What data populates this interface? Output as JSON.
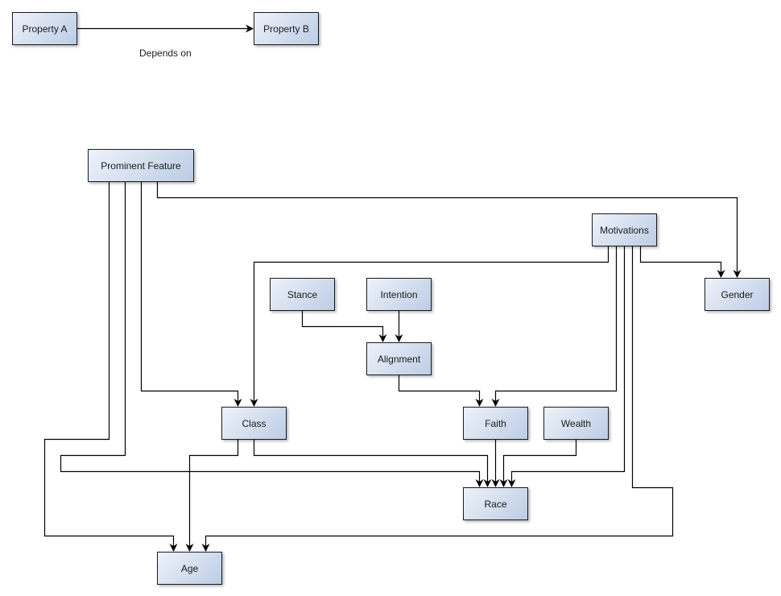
{
  "legend": {
    "source": "Property A",
    "target": "Property B",
    "edge_label": "Depends on"
  },
  "nodes": {
    "prominent_feature": "Prominent Feature",
    "motivations": "Motivations",
    "gender": "Gender",
    "stance": "Stance",
    "intention": "Intention",
    "alignment": "Alignment",
    "class": "Class",
    "faith": "Faith",
    "wealth": "Wealth",
    "race": "Race",
    "age": "Age"
  },
  "edges": [
    {
      "from": "Property A",
      "to": "Property B"
    },
    {
      "from": "Prominent Feature",
      "to": "Age"
    },
    {
      "from": "Prominent Feature",
      "to": "Race"
    },
    {
      "from": "Prominent Feature",
      "to": "Class"
    },
    {
      "from": "Prominent Feature",
      "to": "Gender"
    },
    {
      "from": "Motivations",
      "to": "Class"
    },
    {
      "from": "Motivations",
      "to": "Faith"
    },
    {
      "from": "Motivations",
      "to": "Race"
    },
    {
      "from": "Motivations",
      "to": "Age"
    },
    {
      "from": "Motivations",
      "to": "Gender"
    },
    {
      "from": "Stance",
      "to": "Alignment"
    },
    {
      "from": "Intention",
      "to": "Alignment"
    },
    {
      "from": "Alignment",
      "to": "Faith"
    },
    {
      "from": "Class",
      "to": "Age"
    },
    {
      "from": "Class",
      "to": "Race"
    },
    {
      "from": "Faith",
      "to": "Race"
    },
    {
      "from": "Wealth",
      "to": "Race"
    }
  ]
}
